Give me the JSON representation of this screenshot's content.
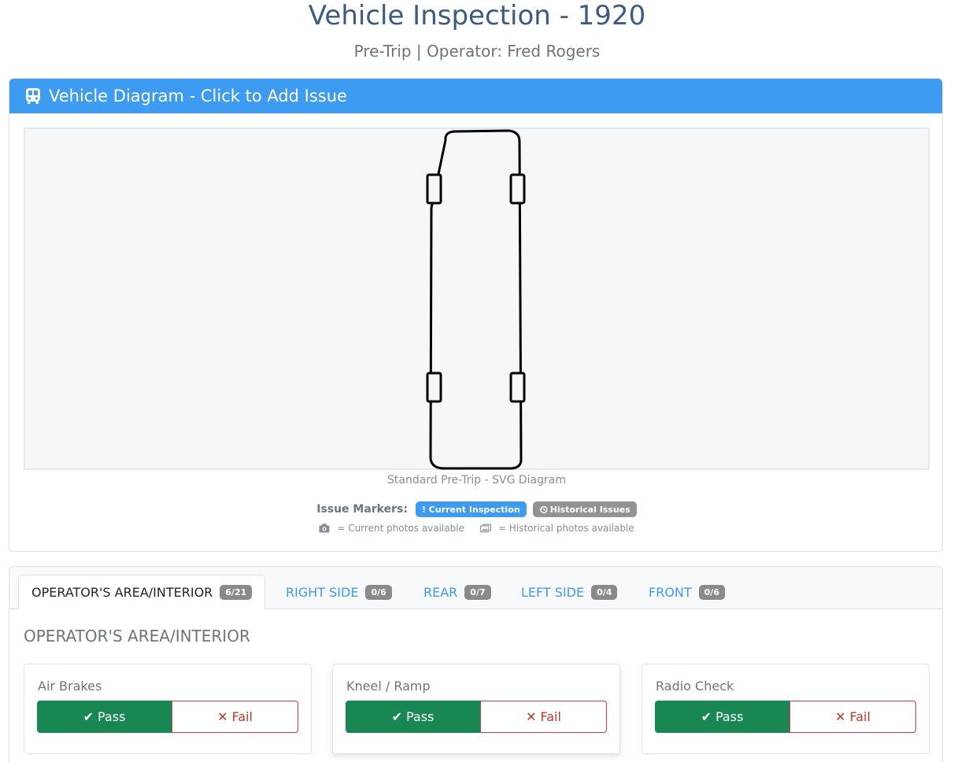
{
  "header": {
    "title": "Vehicle Inspection - 1920",
    "subtitle": "Pre-Trip | Operator: Fred Rogers"
  },
  "diagram": {
    "title": "Vehicle Diagram - Click to Add Issue",
    "icon": "bus-icon",
    "caption": "Standard Pre-Trip - SVG Diagram",
    "markers_label": "Issue Markers:",
    "current_badge": "! Current Inspection",
    "historical_badge": "Historical Issues",
    "current_photos": "= Current photos available",
    "historical_photos": "= Historical photos available"
  },
  "tabs": [
    {
      "label": "OPERATOR'S AREA/INTERIOR",
      "count": "6/21",
      "active": true
    },
    {
      "label": "RIGHT SIDE",
      "count": "0/6",
      "active": false
    },
    {
      "label": "REAR",
      "count": "0/7",
      "active": false
    },
    {
      "label": "LEFT SIDE",
      "count": "0/4",
      "active": false
    },
    {
      "label": "FRONT",
      "count": "0/6",
      "active": false
    }
  ],
  "section": {
    "title": "OPERATOR'S AREA/INTERIOR",
    "items": [
      {
        "name": "Air Brakes",
        "pass": "Pass",
        "fail": "Fail"
      },
      {
        "name": "Kneel / Ramp",
        "pass": "Pass",
        "fail": "Fail"
      },
      {
        "name": "Radio Check",
        "pass": "Pass",
        "fail": "Fail"
      }
    ]
  },
  "colors": {
    "primary": "#3d9bf2",
    "pass": "#198754",
    "fail": "#dc3545",
    "title": "#3d5a80"
  }
}
